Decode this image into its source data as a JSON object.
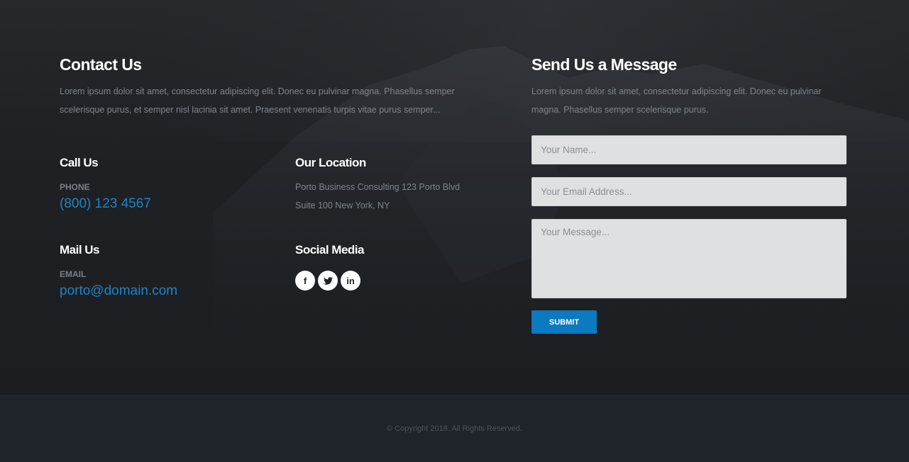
{
  "contact": {
    "title": "Contact Us",
    "description": "Lorem ipsum dolor sit amet, consectetur adipiscing elit. Donec eu pulvinar magna. Phasellus semper scelerisque purus, et semper nisl lacinia sit amet. Praesent venenatis turpis vitae purus semper...",
    "call": {
      "title": "Call Us",
      "label": "PHONE",
      "value": "(800) 123 4567"
    },
    "location": {
      "title": "Our Location",
      "line1": "Porto Business Consulting 123 Porto Blvd",
      "line2": "Suite 100 New York, NY"
    },
    "mail": {
      "title": "Mail Us",
      "label": "EMAIL",
      "value": "porto@domain.com"
    },
    "social": {
      "title": "Social Media",
      "icons": [
        "facebook-icon",
        "twitter-icon",
        "linkedin-icon"
      ]
    }
  },
  "message": {
    "title": "Send Us a Message",
    "description": "Lorem ipsum dolor sit amet, consectetur adipiscing elit. Donec eu pulvinar magna. Phasellus semper scelerisque purus.",
    "name_placeholder": "Your Name...",
    "email_placeholder": "Your Email Address...",
    "message_placeholder": "Your Message...",
    "submit_label": "SUBMIT"
  },
  "footer": {
    "copyright": "© Copyright 2018. All Rights Reserved."
  },
  "colors": {
    "accent": "#0c7ac1",
    "link": "#1d84c8",
    "background": "#1d2127"
  }
}
